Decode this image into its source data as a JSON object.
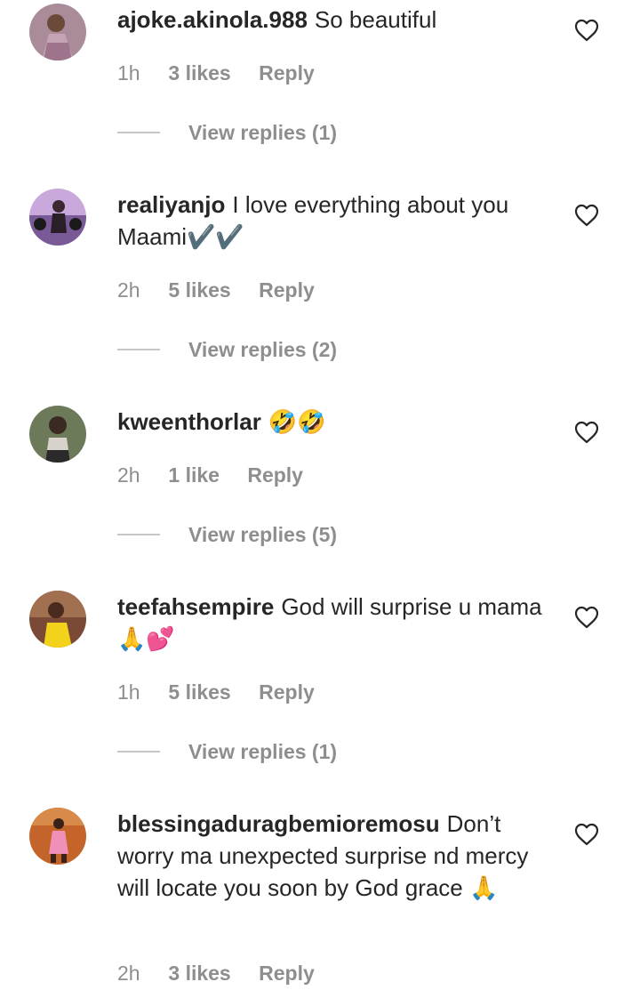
{
  "comments": [
    {
      "username": "ajoke.akinola.988",
      "text": "So beautiful",
      "time": "1h",
      "likes": "3 likes",
      "reply": "Reply",
      "view_replies": "View replies (1)",
      "avatar_color": "#a98b9a"
    },
    {
      "username": "realiyanjo",
      "text": "I love everything about you Maami✔️✔️",
      "time": "2h",
      "likes": "5 likes",
      "reply": "Reply",
      "view_replies": "View replies (2)",
      "avatar_color": "#b58fc9"
    },
    {
      "username": "kweenthorlar",
      "text": "🤣🤣",
      "time": "2h",
      "likes": "1 like",
      "reply": "Reply",
      "view_replies": "View replies (5)",
      "avatar_color": "#5a6a4a"
    },
    {
      "username": "teefahsempire",
      "text": "God will surprise u mama 🙏💕",
      "time": "1h",
      "likes": "5 likes",
      "reply": "Reply",
      "view_replies": "View replies (1)",
      "avatar_color": "#8a5a40"
    },
    {
      "username": "blessingaduragbemioremosu",
      "text": "Don’t worry ma unexpected surprise nd mercy will locate you soon by God grace 🙏",
      "time": "2h",
      "likes": "3 likes",
      "reply": "Reply",
      "avatar_color": "#b8602e"
    }
  ]
}
